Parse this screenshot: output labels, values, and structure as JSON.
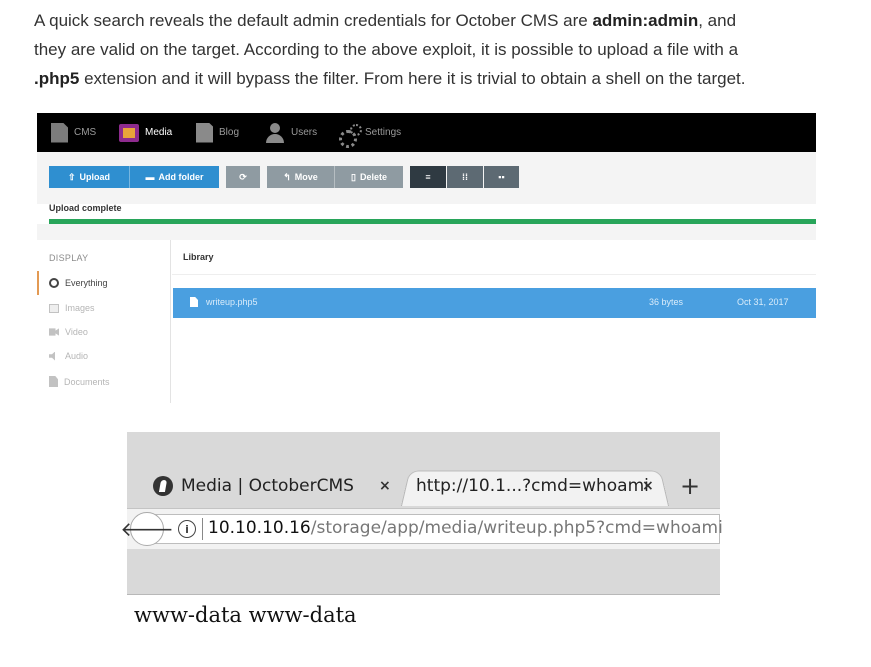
{
  "article": {
    "line1_pre": "A quick search reveals the default admin credentials for October CMS are ",
    "line1_bold": "admin:admin",
    "line1_post": ", and",
    "line2": "they are valid on the target. According to the above exploit, it is possible to upload a file with a",
    "line3_bold": ".php5",
    "line3_post": " extension and it will bypass the filter. From here it is trivial to obtain a shell on the target."
  },
  "cms": {
    "nav": [
      {
        "label": "CMS",
        "icon": "cms-icon"
      },
      {
        "label": "Media",
        "icon": "media-icon",
        "active": true
      },
      {
        "label": "Blog",
        "icon": "blog-icon"
      },
      {
        "label": "Users",
        "icon": "users-icon"
      },
      {
        "label": "Settings",
        "icon": "settings-icon"
      }
    ],
    "toolbar": {
      "upload": "Upload",
      "add_folder": "Add folder",
      "move": "Move",
      "delete": "Delete"
    },
    "upload_status": "Upload complete",
    "upload_progress": 1.0,
    "progress_color": "#28a55a",
    "sidebar": {
      "title": "DISPLAY",
      "items": [
        "Everything",
        "Images",
        "Video",
        "Audio",
        "Documents"
      ]
    },
    "library": {
      "title": "Library",
      "file": {
        "name": "writeup.php5",
        "size": "36 bytes",
        "date": "Oct 31, 2017"
      }
    },
    "accent_color": "#4a9fe0"
  },
  "browser": {
    "tab1_title": "Media | OctoberCMS",
    "tab2_title": "http://10.1...?cmd=whoami",
    "close_glyph": "×",
    "new_tab_glyph": "+",
    "back_glyph": "🡐",
    "info_glyph": "i",
    "url_host": "10.10.10.16",
    "url_path": "/storage/app/media/writeup.php5?cmd=whoami"
  },
  "output": "www-data www-data"
}
